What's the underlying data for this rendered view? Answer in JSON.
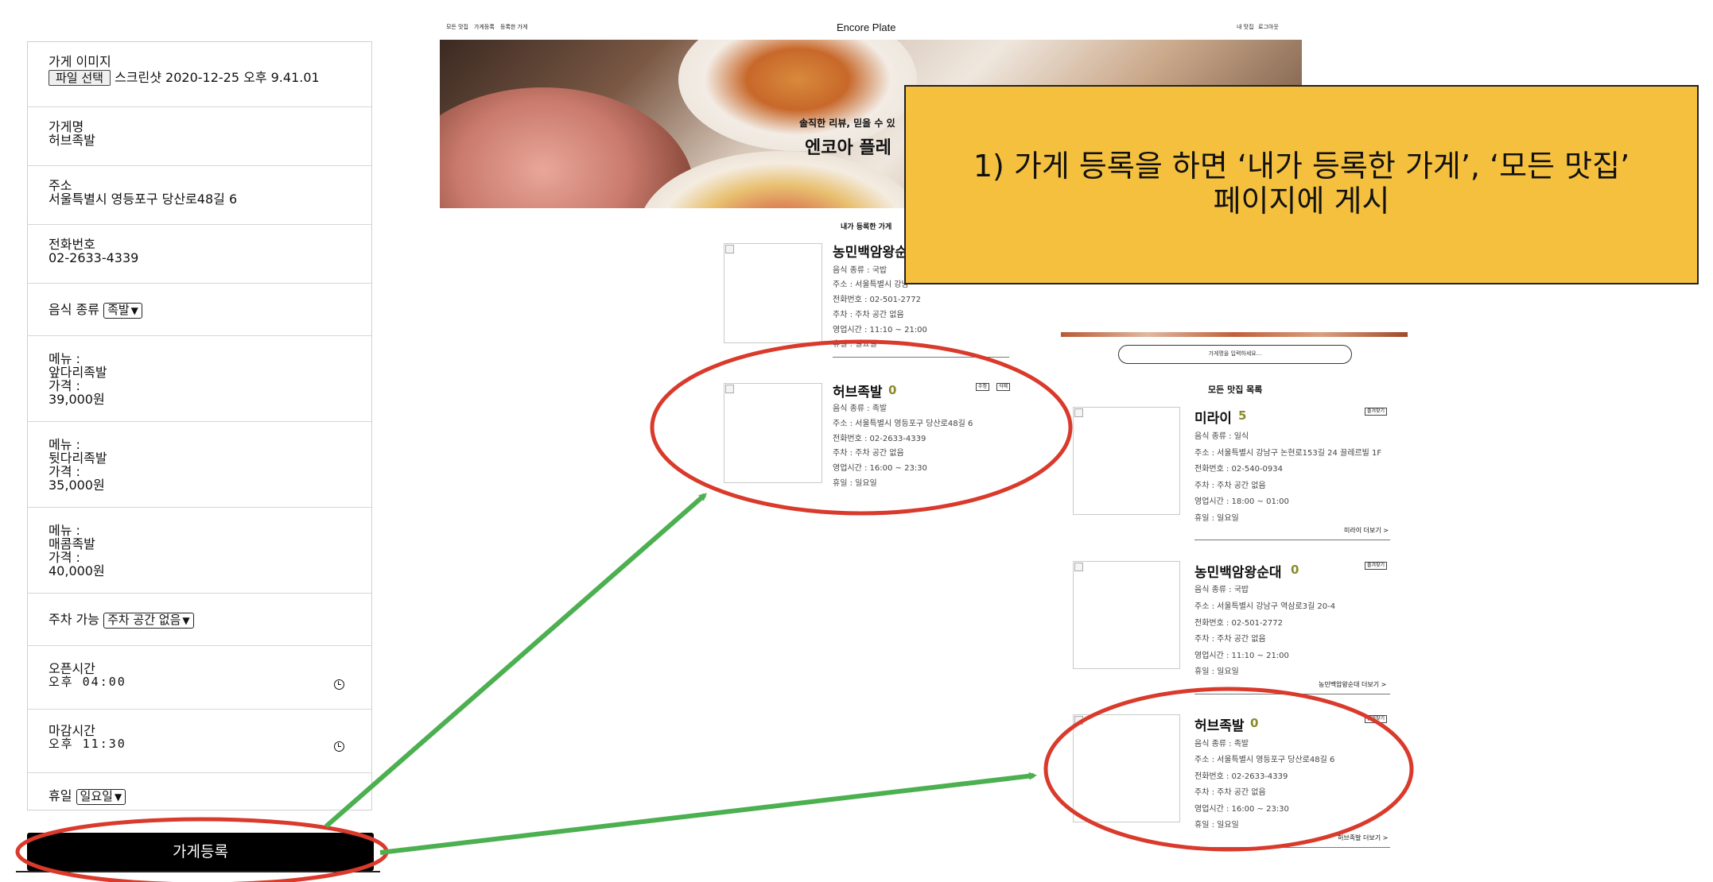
{
  "form": {
    "store_image_label": "가게 이미지",
    "file_button": "파일 선택",
    "file_name": "스크린샷 2020-12-25 오후 9.41.01",
    "name_label": "가게명",
    "name_value": "허브족발",
    "address_label": "주소",
    "address_value": "서울특별시 영등포구 당산로48길 6",
    "phone_label": "전화번호",
    "phone_value": "02-2633-4339",
    "food_type_label": "음식 종류",
    "food_type_value": "족발",
    "menus": [
      {
        "menu_label": "메뉴 :",
        "menu_value": "앞다리족발",
        "price_label": "가격 :",
        "price_value": "39,000원"
      },
      {
        "menu_label": "메뉴 :",
        "menu_value": "뒷다리족발",
        "price_label": "가격 :",
        "price_value": "35,000원"
      },
      {
        "menu_label": "메뉴 :",
        "menu_value": "매콤족발",
        "price_label": "가격 :",
        "price_value": "40,000원"
      }
    ],
    "parking_label": "주차 가능",
    "parking_value": "주차 공간 없음",
    "open_label": "오픈시간",
    "open_value": "오후 04:00",
    "close_label": "마감시간",
    "close_value": "오후 11:30",
    "holiday_label": "휴일",
    "holiday_value": "일요일",
    "submit": "가게등록"
  },
  "my_stores_page": {
    "nav_left": [
      "모든 맛집",
      "가게등록",
      "등록한 가게"
    ],
    "brand": "Encore Plate",
    "nav_right": [
      "내 맛집",
      "로그아웃"
    ],
    "hero_subtitle": "솔직한 리뷰, 믿을 수 있",
    "hero_title": "엔코아 플레",
    "section_title": "내가 등록한 가게",
    "stores": [
      {
        "name": "농민백암왕순",
        "rating": "",
        "lines": [
          "음식 종류 : 국밥",
          "주소 : 서울특별시 강남",
          "전화번호 : 02-501-2772",
          "주차 : 주차 공간 없음",
          "영업시간 : 11:10 ~ 21:00",
          "휴일 : 일요일"
        ]
      },
      {
        "name": "허브족발",
        "rating": "0",
        "edit": "수정",
        "delete": "삭제",
        "lines": [
          "음식 종류 : 족발",
          "주소 : 서울특별시 영등포구 당산로48길 6",
          "전화번호 : 02-2633-4339",
          "주차 : 주차 공간 없음",
          "영업시간 : 16:00 ~ 23:30",
          "휴일 : 일요일"
        ]
      }
    ]
  },
  "all_stores_page": {
    "search_placeholder": "가게명을 입력하세요...",
    "section_title": "모든 맛집 목록",
    "fav_label": "즐겨찾기",
    "stores": [
      {
        "name": "미라이",
        "rating": "5",
        "more": "미라이 더보기 >",
        "lines": [
          "음식 종류 : 일식",
          "주소 : 서울특별시 강남구 논현로153길 24 끌레르빌 1F",
          "전화번호 : 02-540-0934",
          "주차 : 주차 공간 없음",
          "영업시간 : 18:00 ~ 01:00",
          "휴일 : 일요일"
        ]
      },
      {
        "name": "농민백암왕순대",
        "rating": "0",
        "more": "농민백암왕순대 더보기 >",
        "lines": [
          "음식 종류 : 국밥",
          "주소 : 서울특별시 강남구 역삼로3길 20-4",
          "전화번호 : 02-501-2772",
          "주차 : 주차 공간 없음",
          "영업시간 : 11:10 ~ 21:00",
          "휴일 : 일요일"
        ]
      },
      {
        "name": "허브족발",
        "rating": "0",
        "more": "허브족발 더보기 >",
        "lines": [
          "음식 종류 : 족발",
          "주소 : 서울특별시 영등포구 당산로48길 6",
          "전화번호 : 02-2633-4339",
          "주차 : 주차 공간 없음",
          "영업시간 : 16:00 ~ 23:30",
          "휴일 : 일요일"
        ]
      }
    ]
  },
  "callout": {
    "line1": "1) 가게 등록을 하면 ‘내가 등록한 가게’, ‘모든 맛집’",
    "line2": "페이지에 게시"
  },
  "colors": {
    "annotation_red": "#d93a2b",
    "arrow_green": "#4caf50",
    "callout_yellow": "#f4c03e",
    "rating_olive": "#8a8a2a"
  }
}
